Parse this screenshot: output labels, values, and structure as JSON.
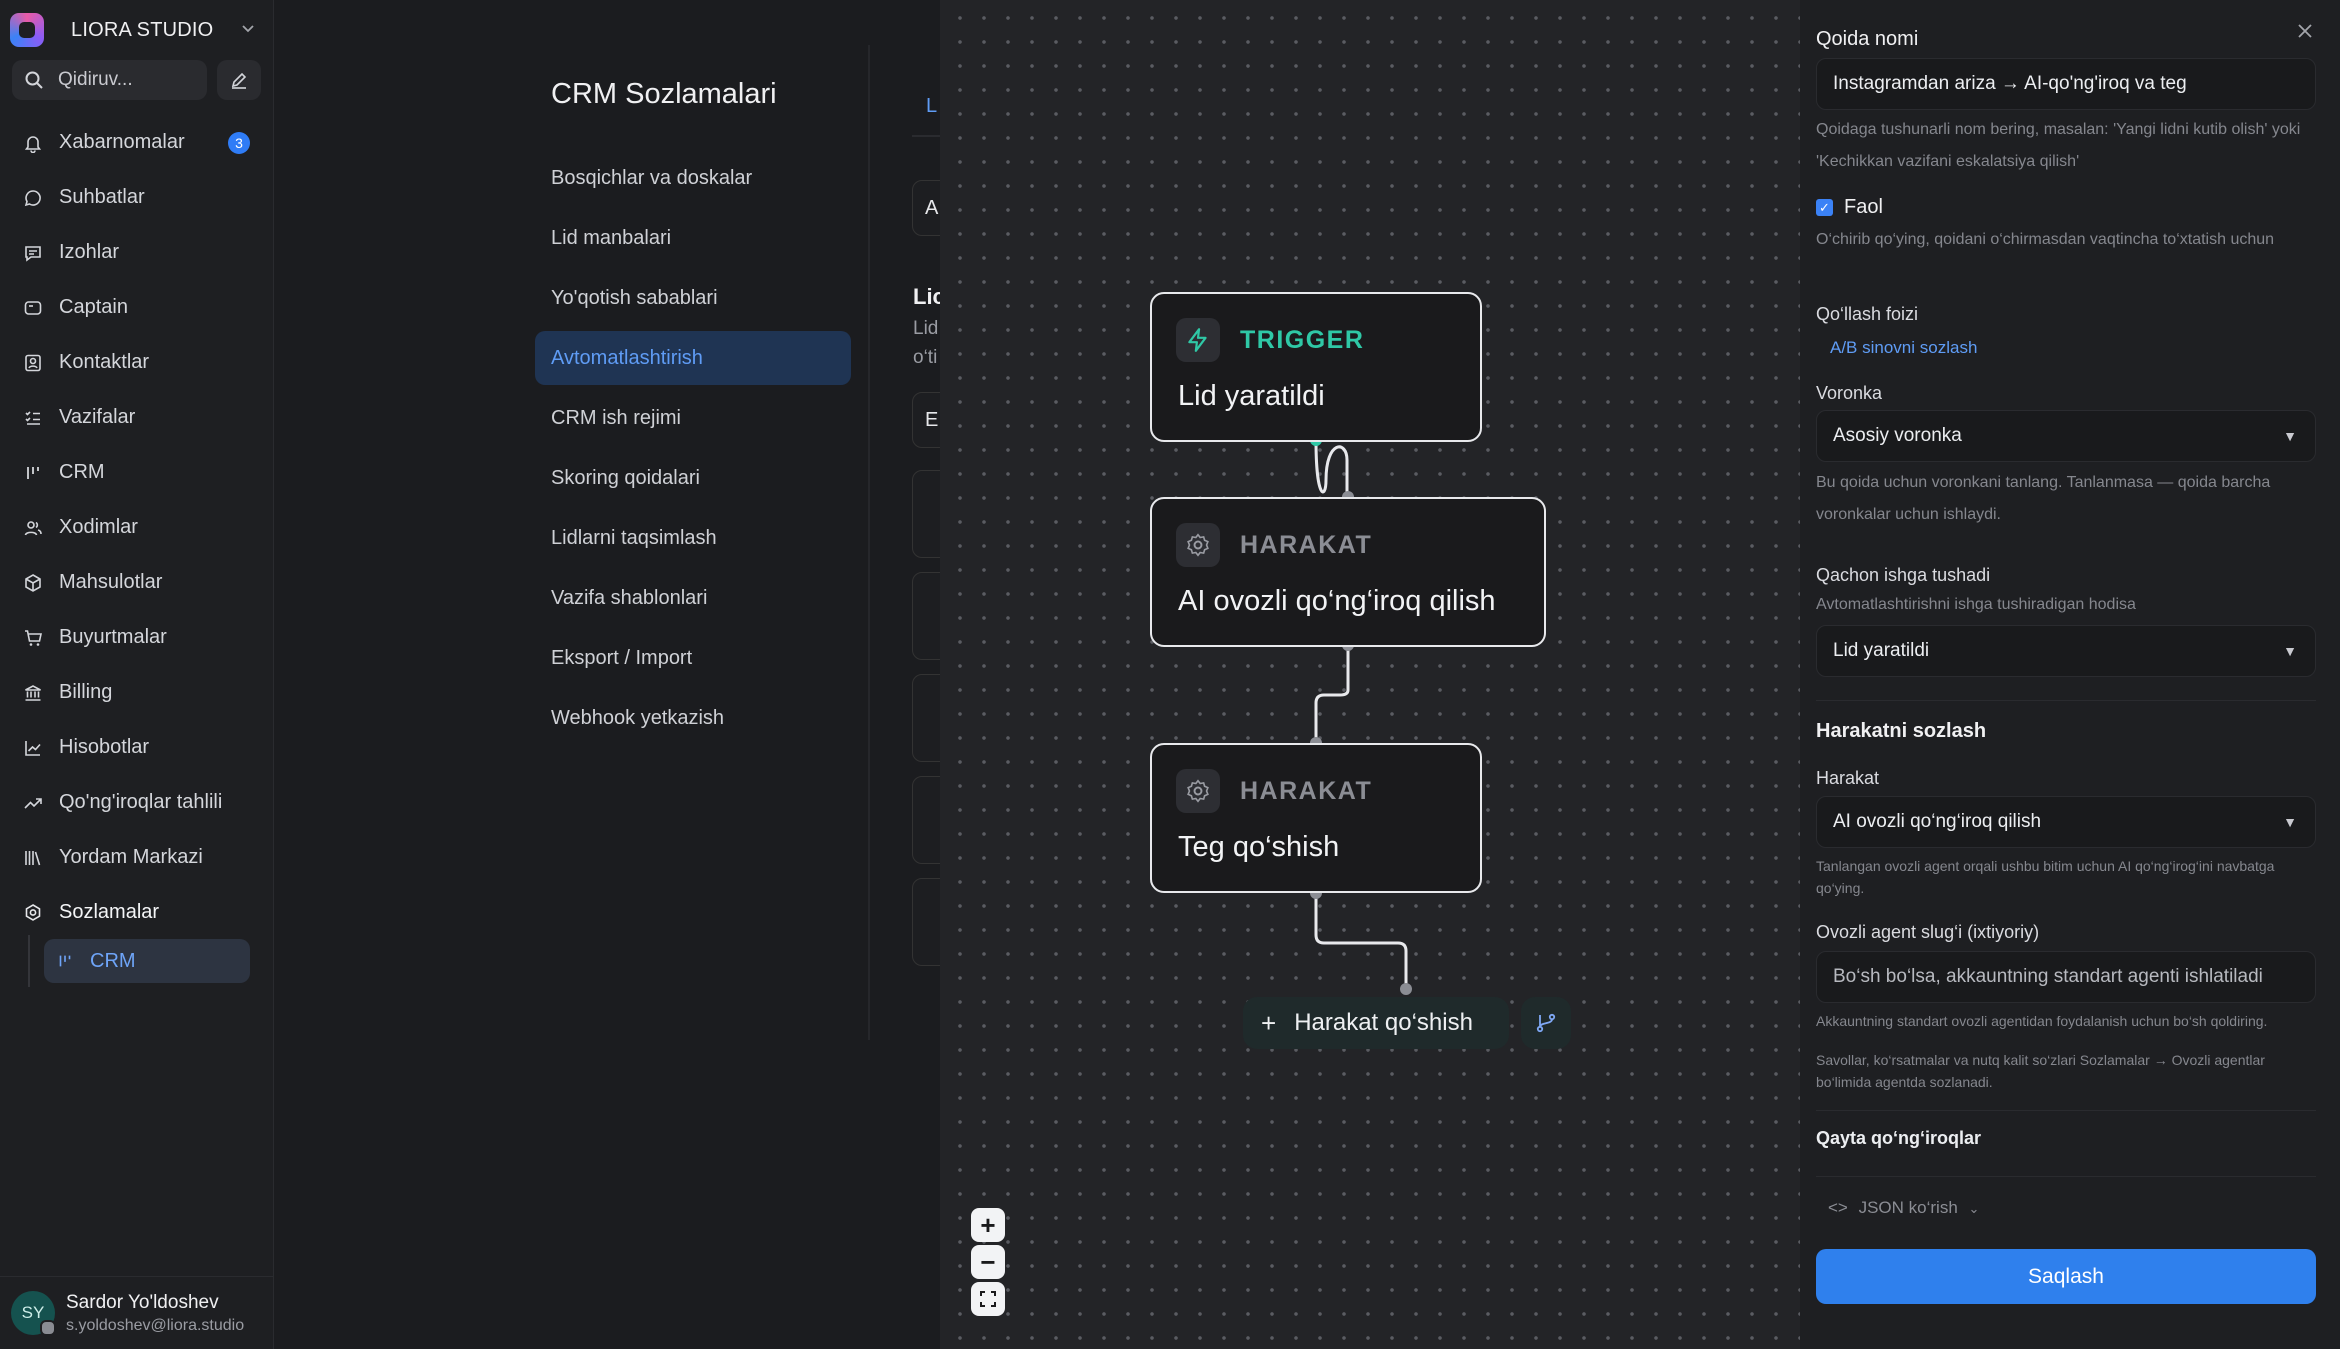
{
  "sidebar": {
    "brand": "LIORA STUDIO",
    "search_placeholder": "Qidiruv...",
    "items": [
      {
        "label": "Xabarnomalar",
        "icon": "bell-icon",
        "badge": "3"
      },
      {
        "label": "Suhbatlar",
        "icon": "chat-icon"
      },
      {
        "label": "Izohlar",
        "icon": "note-icon"
      },
      {
        "label": "Captain",
        "icon": "captain-icon"
      },
      {
        "label": "Kontaktlar",
        "icon": "contacts-icon"
      },
      {
        "label": "Vazifalar",
        "icon": "tasks-icon"
      },
      {
        "label": "CRM",
        "icon": "crm-icon"
      },
      {
        "label": "Xodimlar",
        "icon": "users-icon"
      },
      {
        "label": "Mahsulotlar",
        "icon": "box-icon"
      },
      {
        "label": "Buyurtmalar",
        "icon": "cart-icon"
      },
      {
        "label": "Billing",
        "icon": "bank-icon"
      },
      {
        "label": "Hisobotlar",
        "icon": "chart-icon"
      },
      {
        "label": "Qo'ng'iroqlar tahlili",
        "icon": "trend-icon"
      },
      {
        "label": "Yordam Markazi",
        "icon": "library-icon"
      },
      {
        "label": "Sozlamalar",
        "icon": "settings-icon"
      }
    ],
    "subitem": "CRM",
    "user": {
      "initials": "SY",
      "name": "Sardor Yo'ldoshev",
      "email": "s.yoldoshev@liora.studio"
    }
  },
  "settings": {
    "title": "CRM Sozlamalari",
    "items": [
      "Bosqichlar va doskalar",
      "Lid manbalari",
      "Yo'qotish sabablari",
      "Avtomatlashtirish",
      "CRM ish rejimi",
      "Skoring qoidalari",
      "Lidlarni taqsimlash",
      "Vazifa shablonlari",
      "Eksport / Import",
      "Webhook yetkazish"
    ],
    "active_index": 3
  },
  "peek": {
    "tab": "L",
    "box1": "A",
    "heading": "Lic",
    "line1": "Lid",
    "line2": "o‘ti",
    "box2": "E"
  },
  "flow": {
    "trigger": {
      "kind": "TRIGGER",
      "title": "Lid yaratildi"
    },
    "action1": {
      "kind": "HARAKAT",
      "title": "AI ovozli qo‘ng‘iroq qilish"
    },
    "action2": {
      "kind": "HARAKAT",
      "title": "Teg qo‘shish"
    },
    "add_action": "Harakat qo‘shish"
  },
  "panel": {
    "rule_name_label": "Qoida nomi",
    "rule_name_value": "Instagramdan ariza → AI-qo'ng'iroq va teg",
    "rule_name_help": "Qoidaga tushunarli nom bering, masalan: 'Yangi lidni kutib olish' yoki 'Kechikkan vazifani eskalatsiya qilish'",
    "active_label": "Faol",
    "active_help": "O‘chirib qo‘ying, qoidani o‘chirmasdan vaqtincha to‘xtatish uchun",
    "apply_pct_label": "Qo‘llash foizi",
    "ab_link": "A/B sinovni sozlash",
    "funnel_label": "Voronka",
    "funnel_value": "Asosiy voronka",
    "funnel_help": "Bu qoida uchun voronkani tanlang. Tanlanmasa — qoida barcha voronkalar uchun ishlaydi.",
    "when_label": "Qachon ishga tushadi",
    "when_help": "Avtomatlashtirishni ishga tushiradigan hodisa",
    "when_value": "Lid yaratildi",
    "action_section": "Harakatni sozlash",
    "action_label": "Harakat",
    "action_value": "AI ovozli qo‘ng‘iroq qilish",
    "action_help": "Tanlangan ovozli agent orqali ushbu bitim uchun AI qo‘ng‘irog‘ini navbatga qo‘ying.",
    "agent_label": "Ovozli agent slug‘i (ixtiyoriy)",
    "agent_placeholder": "Bo‘sh bo‘lsa, akkauntning standart agenti ishlatiladi",
    "agent_help": "Akkauntning standart ovozli agentidan foydalanish uchun bo‘sh qoldiring.",
    "agent_help2": "Savollar, ko‘rsatmalar va nutq kalit so‘zlari Sozlamalar → Ovozli agentlar bo‘limida agentda sozlanadi.",
    "retries_label": "Qayta qo‘ng‘iroqlar",
    "json_toggle": "JSON ko‘rish",
    "save": "Saqlash"
  },
  "colors": {
    "accent": "#2f80ed",
    "trigger": "#2fc8a6",
    "canvas": "#232427",
    "panel": "#1e1f22"
  }
}
